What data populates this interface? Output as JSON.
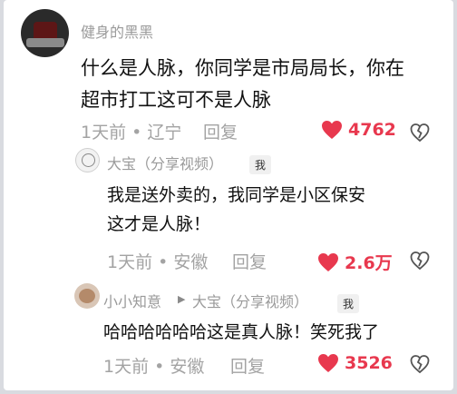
{
  "comments": [
    {
      "author": "健身的黑黑",
      "text_line1": "什么是人脉，你同学是市局局长，你在",
      "text_line2": "超市打工这可不是人脉",
      "time_location": "1天前 • 辽宁",
      "reply_label": "回复",
      "likes": "4762"
    },
    {
      "author": "大宝（分享视频）",
      "tag": "我",
      "text_line1": "我是送外卖的，我同学是小区保安",
      "text_line2": "这才是人脉！",
      "time_location": "1天前 • 安徽",
      "reply_label": "回复",
      "likes": "2.6万"
    },
    {
      "author": "小小知意",
      "reply_to": "大宝（分享视频）",
      "tag": "我",
      "text_line1": "哈哈哈哈哈哈这是真人脉！笑死我了",
      "time_location": "1天前 • 安徽",
      "reply_label": "回复",
      "likes": "3526"
    }
  ],
  "icons": {
    "like": "heart-icon",
    "dislike": "broken-heart-icon",
    "reply_to": "play-arrow-icon"
  },
  "colors": {
    "like_red": "#e8384e",
    "meta_gray": "#a3a3a3"
  }
}
